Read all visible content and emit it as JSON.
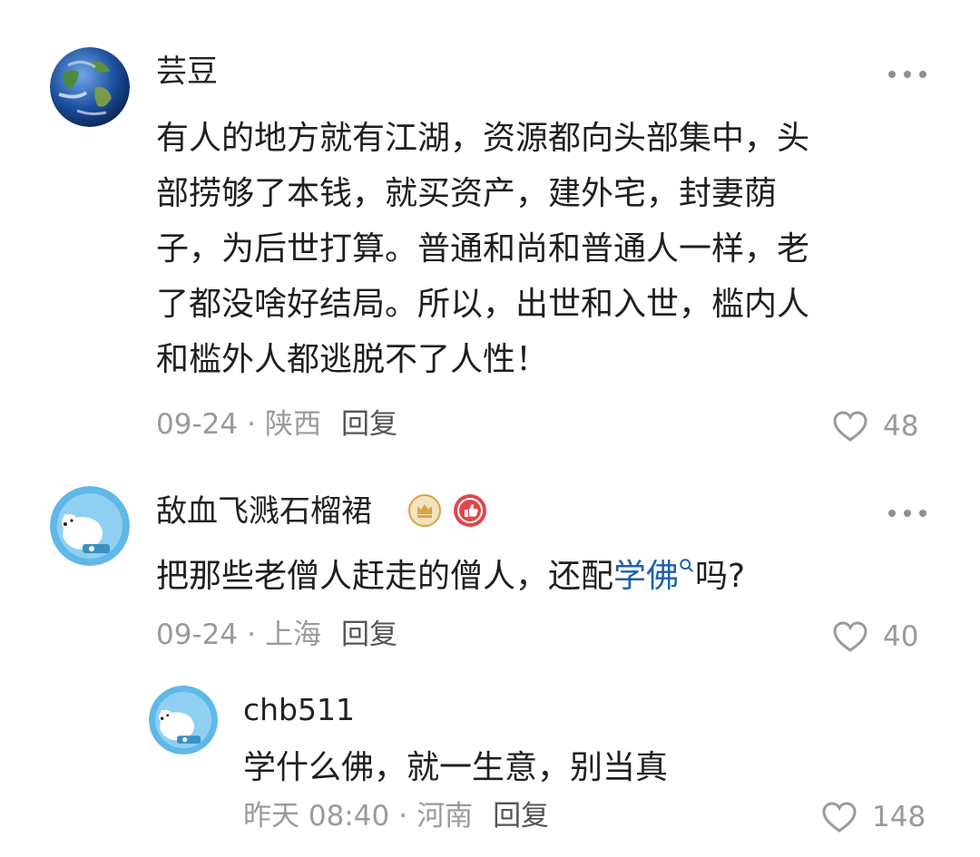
{
  "comments": [
    {
      "username": "芸豆",
      "avatar_icon": "earth-globe-avatar",
      "text_lines": [
        "有人的地方就有江湖，资源都向头部集中，头",
        "部捞够了本钱，就买资产，建外宅，封妻荫",
        "子，为后世打算。普通和尚和普通人一样，老",
        "了都没啥好结局。所以，出世和入世，槛内人",
        "和槛外人都逃脱不了人性！"
      ],
      "date": "09-24",
      "location": "陕西",
      "reply_label": "回复",
      "likes": "48"
    },
    {
      "username": "敌血飞溅石榴裙",
      "avatar_icon": "polar-bear-avatar",
      "badges": [
        "crown-badge-icon",
        "thumbs-up-badge-icon"
      ],
      "text_before_link": "把那些老僧人赶走的僧人，还配",
      "link_text": "学佛",
      "text_after_link": "吗?",
      "date": "09-24",
      "location": "上海",
      "reply_label": "回复",
      "likes": "40"
    },
    {
      "username": "chb511",
      "avatar_icon": "polar-bear-avatar",
      "text": "学什么佛，就一生意，别当真",
      "date": "昨天 08:40",
      "location": "河南",
      "reply_label": "回复",
      "likes": "148"
    }
  ],
  "colors": {
    "link": "#1e5fa8",
    "meta": "#9a9a9a",
    "badge_gold": "#d9a441",
    "badge_red": "#e0464c"
  }
}
